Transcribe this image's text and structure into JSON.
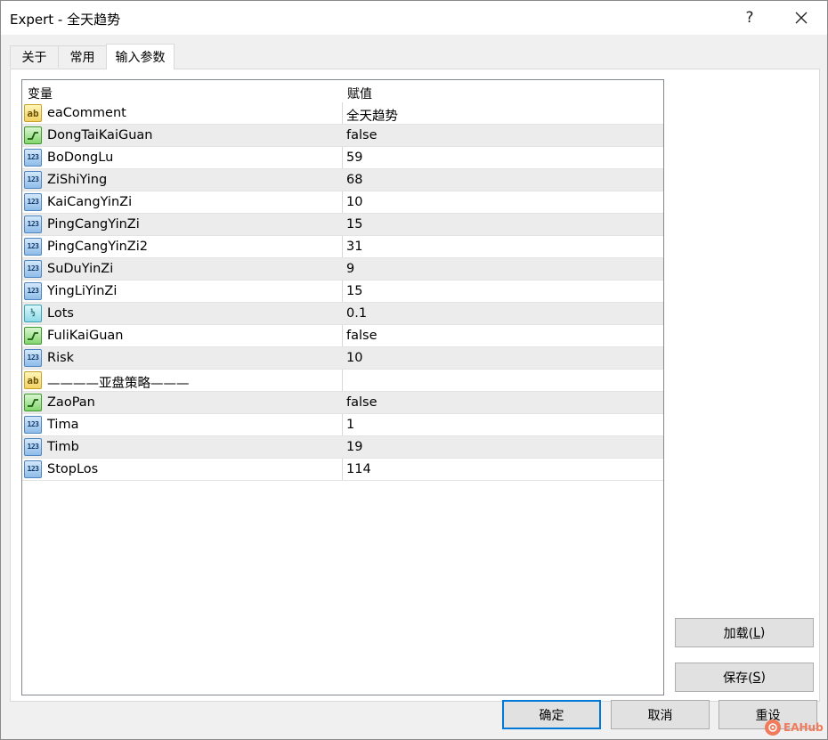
{
  "window": {
    "title": "Expert - 全天趋势",
    "help_label": "?"
  },
  "tabs": [
    {
      "label": "关于",
      "active": false
    },
    {
      "label": "常用",
      "active": false
    },
    {
      "label": "输入参数",
      "active": true
    }
  ],
  "grid": {
    "headers": {
      "variable": "变量",
      "value": "赋值"
    },
    "rows": [
      {
        "icon": "string-icon",
        "name": "eaComment",
        "value": "全天趋势"
      },
      {
        "icon": "bool-icon",
        "name": "DongTaiKaiGuan",
        "value": "false"
      },
      {
        "icon": "number-icon",
        "name": "BoDongLu",
        "value": "59"
      },
      {
        "icon": "number-icon",
        "name": "ZiShiYing",
        "value": "68"
      },
      {
        "icon": "number-icon",
        "name": "KaiCangYinZi",
        "value": "10"
      },
      {
        "icon": "number-icon",
        "name": "PingCangYinZi",
        "value": "15"
      },
      {
        "icon": "number-icon",
        "name": "PingCangYinZi2",
        "value": "31"
      },
      {
        "icon": "number-icon",
        "name": "SuDuYinZi",
        "value": "9"
      },
      {
        "icon": "number-icon",
        "name": "YingLiYinZi",
        "value": "15"
      },
      {
        "icon": "double-icon",
        "name": "Lots",
        "value": "0.1"
      },
      {
        "icon": "bool-icon",
        "name": "FuliKaiGuan",
        "value": "false"
      },
      {
        "icon": "number-icon",
        "name": "Risk",
        "value": "10"
      },
      {
        "icon": "string-icon",
        "name": "————亚盘策略———",
        "value": ""
      },
      {
        "icon": "bool-icon",
        "name": "ZaoPan",
        "value": "false"
      },
      {
        "icon": "number-icon",
        "name": "Tima",
        "value": "1"
      },
      {
        "icon": "number-icon",
        "name": "Timb",
        "value": "19"
      },
      {
        "icon": "number-icon",
        "name": "StopLos",
        "value": "114"
      }
    ]
  },
  "side_buttons": {
    "load": {
      "label": "加载(",
      "hotkey": "L",
      "suffix": ")"
    },
    "save": {
      "label": "保存(",
      "hotkey": "S",
      "suffix": ")"
    }
  },
  "bottom_buttons": {
    "ok": "确定",
    "cancel": "取消",
    "reset": "重设"
  },
  "watermark": {
    "text": "EAHub"
  },
  "colors": {
    "focus_border": "#0078d7",
    "alt_row": "#ececec",
    "watermark": "#f07a5a"
  }
}
